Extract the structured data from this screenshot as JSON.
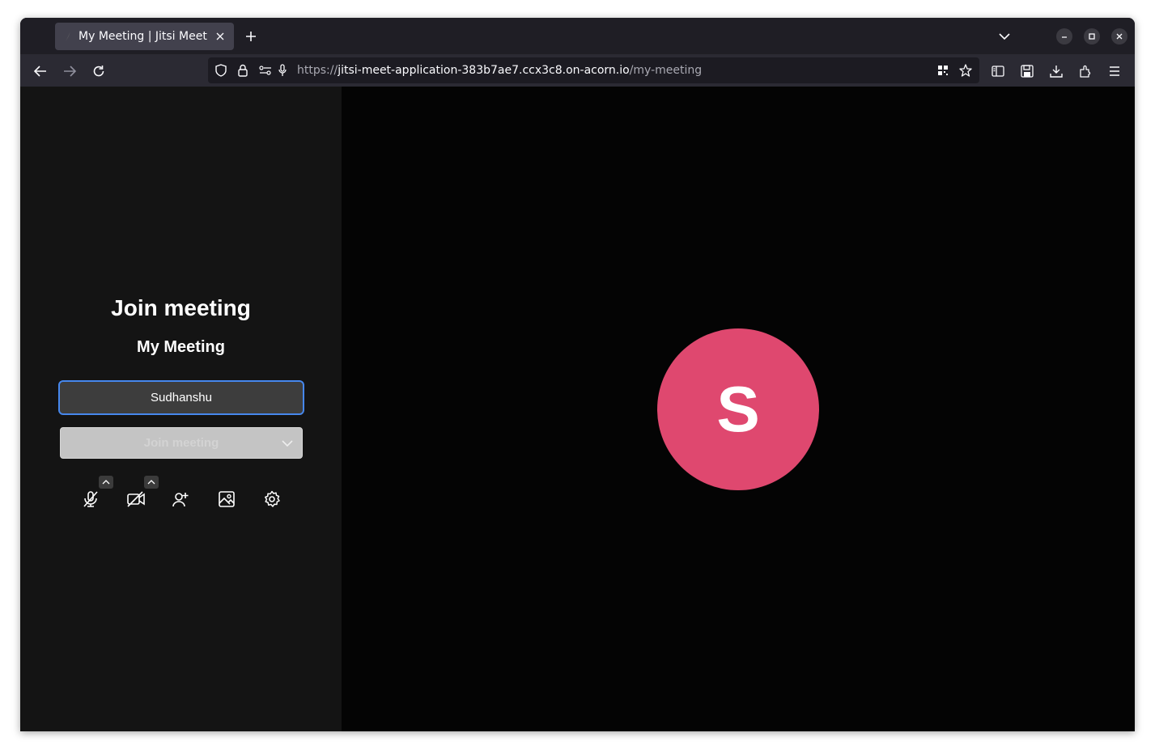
{
  "browser": {
    "tab": {
      "title": "My Meeting | Jitsi Meet"
    },
    "url": {
      "host_part": "jitsi-meet-application-383b7ae7.ccx3c8.on-acorn.io",
      "prefix": "https://",
      "path": "/my-meeting"
    }
  },
  "prejoin": {
    "title": "Join meeting",
    "meeting_name": "My Meeting",
    "name_input_value": "Sudhanshu",
    "join_button_label": "Join meeting",
    "toolbar": [
      "mic-muted-icon",
      "camera-off-icon",
      "invite-icon",
      "background-icon",
      "settings-icon"
    ]
  },
  "preview": {
    "avatar_initial": "S",
    "avatar_color": "#df486f"
  }
}
